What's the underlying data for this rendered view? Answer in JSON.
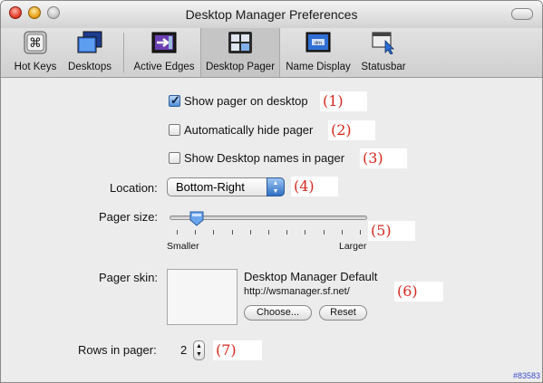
{
  "window": {
    "title": "Desktop Manager Preferences"
  },
  "toolbar": {
    "items": [
      {
        "label": "Hot Keys",
        "icon": "command-key-icon"
      },
      {
        "label": "Desktops",
        "icon": "desktops-icon"
      },
      {
        "label": "Active Edges",
        "icon": "active-edges-icon"
      },
      {
        "label": "Desktop Pager",
        "icon": "pager-grid-icon",
        "selected": true
      },
      {
        "label": "Name Display",
        "icon": "name-display-icon"
      },
      {
        "label": "Statusbar",
        "icon": "statusbar-icon"
      }
    ]
  },
  "options": {
    "show_pager": {
      "label": "Show pager on desktop",
      "checked": true
    },
    "auto_hide": {
      "label": "Automatically hide pager",
      "checked": false
    },
    "show_names": {
      "label": "Show Desktop names in pager",
      "checked": false
    }
  },
  "location": {
    "label": "Location:",
    "value": "Bottom-Right"
  },
  "pager_size": {
    "label": "Pager size:",
    "min_label": "Smaller",
    "max_label": "Larger",
    "value_fraction": 0.11
  },
  "pager_skin": {
    "label": "Pager skin:",
    "name": "Desktop Manager Default",
    "url": "http://wsmanager.sf.net/",
    "choose_label": "Choose...",
    "reset_label": "Reset"
  },
  "rows": {
    "label": "Rows in pager:",
    "value": "2"
  },
  "markers": [
    "(1)",
    "(2)",
    "(3)",
    "(4)",
    "(5)",
    "(6)",
    "(7)"
  ],
  "corner_text": "#83583",
  "colors": {
    "marker": "#d5281f",
    "accent": "#3b7fd4"
  }
}
